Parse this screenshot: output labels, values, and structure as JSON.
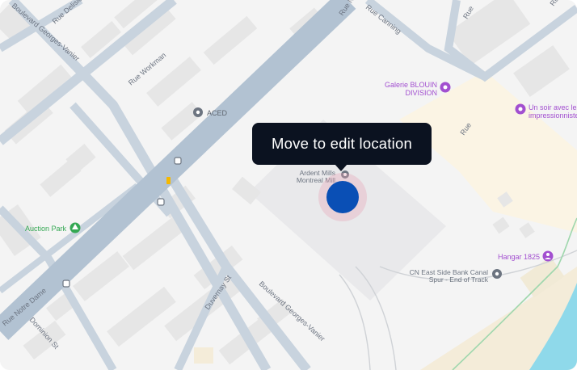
{
  "tooltip": {
    "text": "Move to edit location"
  },
  "colors": {
    "land": "#f4f4f4",
    "building": "#e6e6e6",
    "main_road": "#b2c2d2",
    "minor_road": "#c8d3de",
    "water": "#8fd9ea",
    "industrial": "#e9e9eb",
    "park_lot": "#fbf4e4",
    "sand": "#f4ecd9",
    "poi_purple": "#a24fd0",
    "poi_green": "#34a853",
    "poi_gray": "#6c7480",
    "marker": "#0a4fb5",
    "tooltip_bg": "#0b1220"
  },
  "streets": [
    "Boulevard Georges-Vanier",
    "Rue Delisle",
    "Rue Workman",
    "Rue Notre Dame",
    "Rue Canning",
    "Rue Notre",
    "Rue",
    "Dominion St",
    "Duvernay St",
    "Boulevard Georges-Vanier",
    "Rue",
    "Rue"
  ],
  "pois": [
    {
      "name": "ACED",
      "icon": "pin-icon"
    },
    {
      "name": "Galerie BLOUIN",
      "name2": "DIVISION",
      "icon": "gallery-icon"
    },
    {
      "name": "Un soir avec les",
      "name2": "impressionnistes",
      "icon": "gallery-icon"
    },
    {
      "name": "Ardent Mills",
      "name2": "Montreal Mill",
      "icon": "pin-icon"
    },
    {
      "name": "Auction Park",
      "icon": "park-icon"
    },
    {
      "name": "Hangar 1825",
      "icon": "venue-icon"
    },
    {
      "name": "CN East Side Bank Canal",
      "name2": "Spur - End of Track",
      "icon": "pin-icon"
    }
  ]
}
